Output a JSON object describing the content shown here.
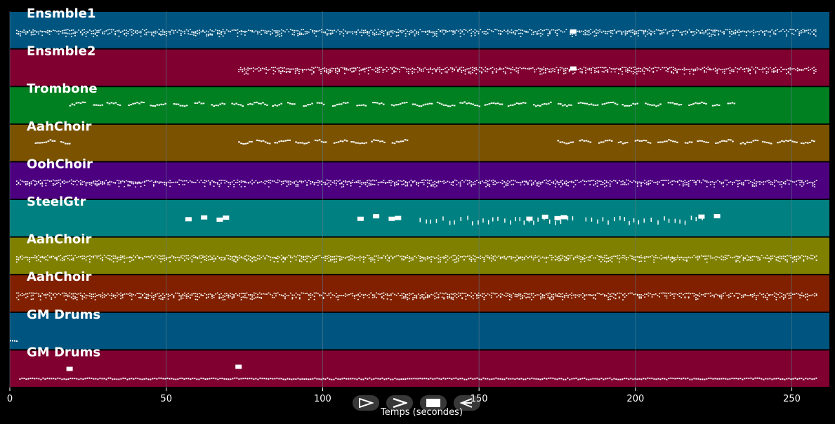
{
  "colors": {
    "background": "#000000",
    "grid": "#5a7a8a",
    "axis_text": "#ffffff",
    "note": "#ffffff"
  },
  "player": {
    "controls": [
      {
        "name": "rewind-button",
        "icon": "rewind-icon"
      },
      {
        "name": "fast-forward-button",
        "icon": "fast-forward-icon"
      },
      {
        "name": "stop-button",
        "icon": "stop-icon"
      },
      {
        "name": "play-button",
        "icon": "play-icon"
      }
    ]
  },
  "chart_data": {
    "type": "piano-roll",
    "xlabel": "Temps (secondes)",
    "xlim": [
      0,
      262
    ],
    "xticks": [
      0,
      50,
      100,
      150,
      200,
      250
    ],
    "grid": true,
    "tracks": [
      {
        "name": "Ensmble1",
        "color": "#005580",
        "density": "high",
        "segments": [
          [
            2,
            178
          ],
          [
            179,
            182
          ],
          [
            182,
            230
          ],
          [
            230,
            258
          ]
        ],
        "blocks": [
          180
        ]
      },
      {
        "name": "Ensmble2",
        "color": "#800030",
        "density": "high",
        "segments": [
          [
            73,
            258
          ]
        ],
        "blocks": [
          180
        ]
      },
      {
        "name": "Trombone",
        "color": "#008020",
        "density": "phrase",
        "segments": [
          [
            19,
            232
          ]
        ],
        "blocks": []
      },
      {
        "name": "AahChoir",
        "color": "#7a5200",
        "density": "phrase",
        "segments": [
          [
            8,
            19
          ],
          [
            73,
            127
          ],
          [
            175,
            258
          ]
        ],
        "blocks": []
      },
      {
        "name": "OohChoir",
        "color": "#4c0080",
        "density": "high",
        "segments": [
          [
            2,
            258
          ]
        ],
        "blocks": []
      },
      {
        "name": "SteelGtr",
        "color": "#008080",
        "density": "sparse",
        "segments": [
          [
            131,
            180
          ],
          [
            184,
            222
          ]
        ],
        "blocks": [
          57,
          62,
          67,
          69,
          112,
          117,
          122,
          124,
          166,
          171,
          175,
          177,
          221,
          226
        ]
      },
      {
        "name": "AahChoir",
        "color": "#808000",
        "density": "high",
        "segments": [
          [
            2,
            258
          ]
        ],
        "blocks": []
      },
      {
        "name": "AahChoir",
        "color": "#802000",
        "density": "high",
        "segments": [
          [
            2,
            258
          ]
        ],
        "blocks": []
      },
      {
        "name": "GM Drums",
        "color": "#005580",
        "density": "dots",
        "segments": [
          [
            0,
            2.5
          ]
        ],
        "blocks": []
      },
      {
        "name": "GM Drums",
        "color": "#800030",
        "density": "dots",
        "segments": [
          [
            3,
            258
          ]
        ],
        "blocks": [
          19,
          73
        ]
      }
    ]
  }
}
